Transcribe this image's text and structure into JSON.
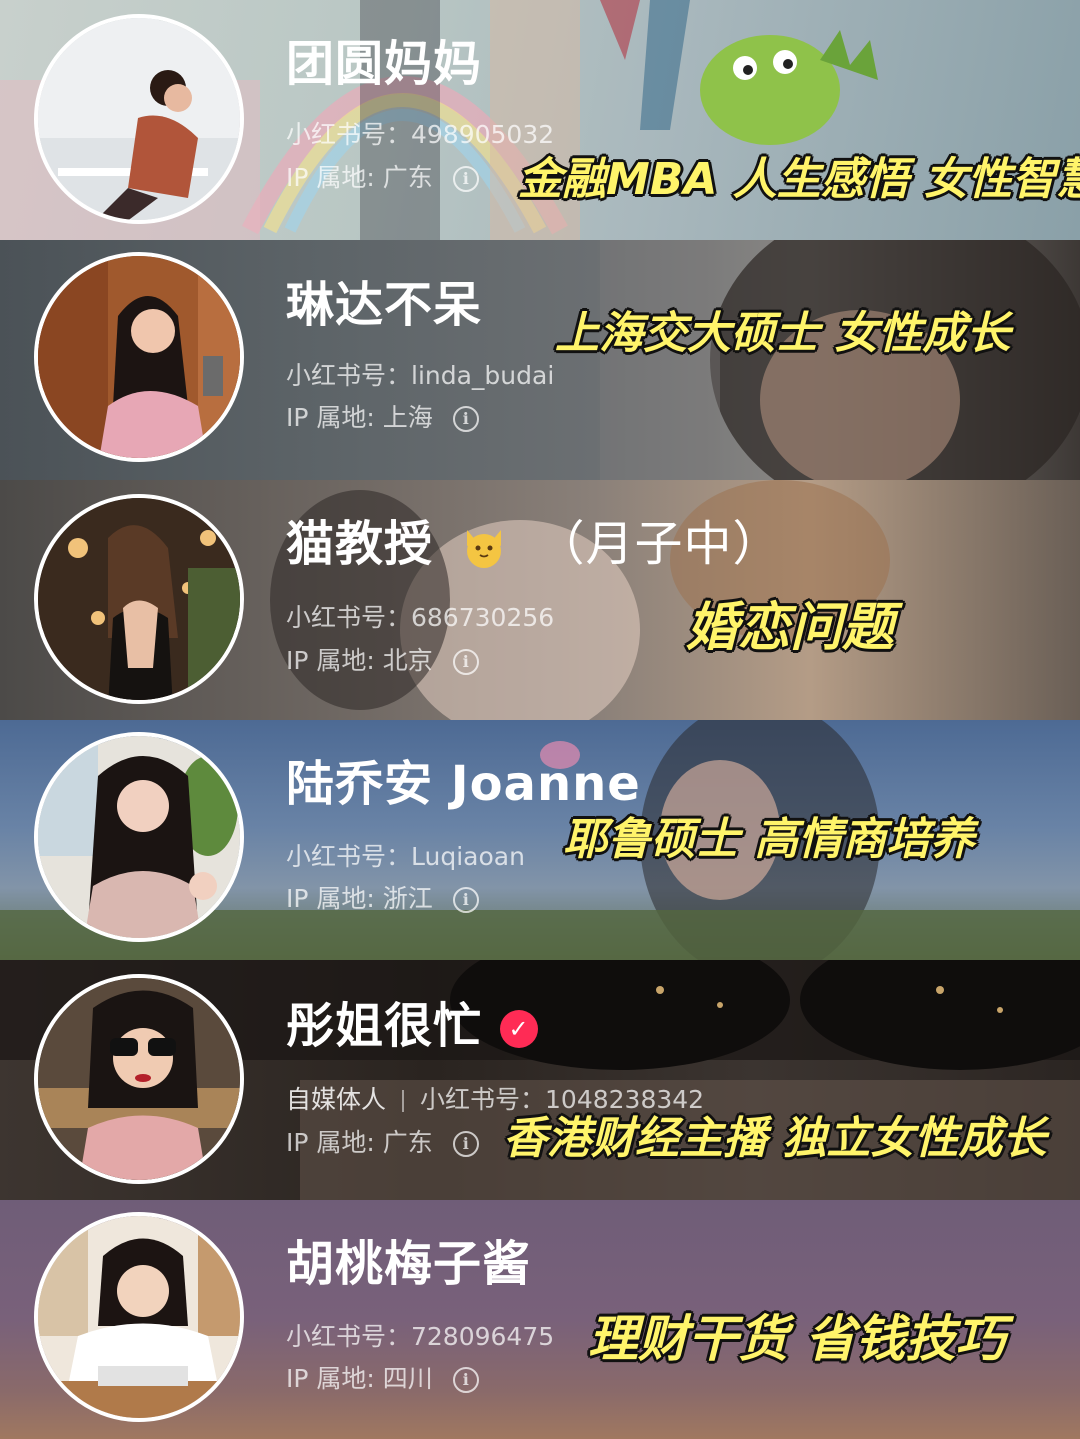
{
  "colors": {
    "tag_text": "#fff46a",
    "verified_badge": "#ff2b55"
  },
  "accounts": [
    {
      "name": "团圆妈妈",
      "xhs_id": "小红书号：498905032",
      "ip": "IP 属地: 广东",
      "tag": "金融MBA 人生感悟 女性智慧",
      "bg_theme": "cartoon-castle"
    },
    {
      "name": "琳达不呆",
      "xhs_id": "小红书号：linda_budai",
      "ip": "IP 属地: 上海",
      "tag": "上海交大硕士 女性成长",
      "bg_theme": "film-still"
    },
    {
      "name": "猫教授",
      "name_suffix": "（月子中）",
      "name_icon": "cat-face-icon",
      "xhs_id": "小红书号：686730256",
      "ip": "IP 属地: 北京",
      "tag": "婚恋问题",
      "bg_theme": "couple-cat"
    },
    {
      "name": "陆乔安 Joanne",
      "xhs_id": "小红书号：Luqiaoan",
      "ip": "IP 属地: 浙江",
      "tag": "耶鲁硕士 高情商培养",
      "bg_theme": "sky-field"
    },
    {
      "name": "彤姐很忙",
      "name_icon": "verified-check-icon",
      "role": "自媒体人",
      "xhs_id": "小红书号：1048238342",
      "ip": "IP 属地: 广东",
      "tag": "香港财经主播 独立女性成长",
      "bg_theme": "sunglasses-dark"
    },
    {
      "name": "胡桃梅子酱",
      "xhs_id": "小红书号：728096475",
      "ip": "IP 属地: 四川",
      "tag": "理财干货 省钱技巧",
      "bg_theme": "sunset-purple"
    }
  ],
  "info_glyph": "i",
  "check_glyph": "✓"
}
